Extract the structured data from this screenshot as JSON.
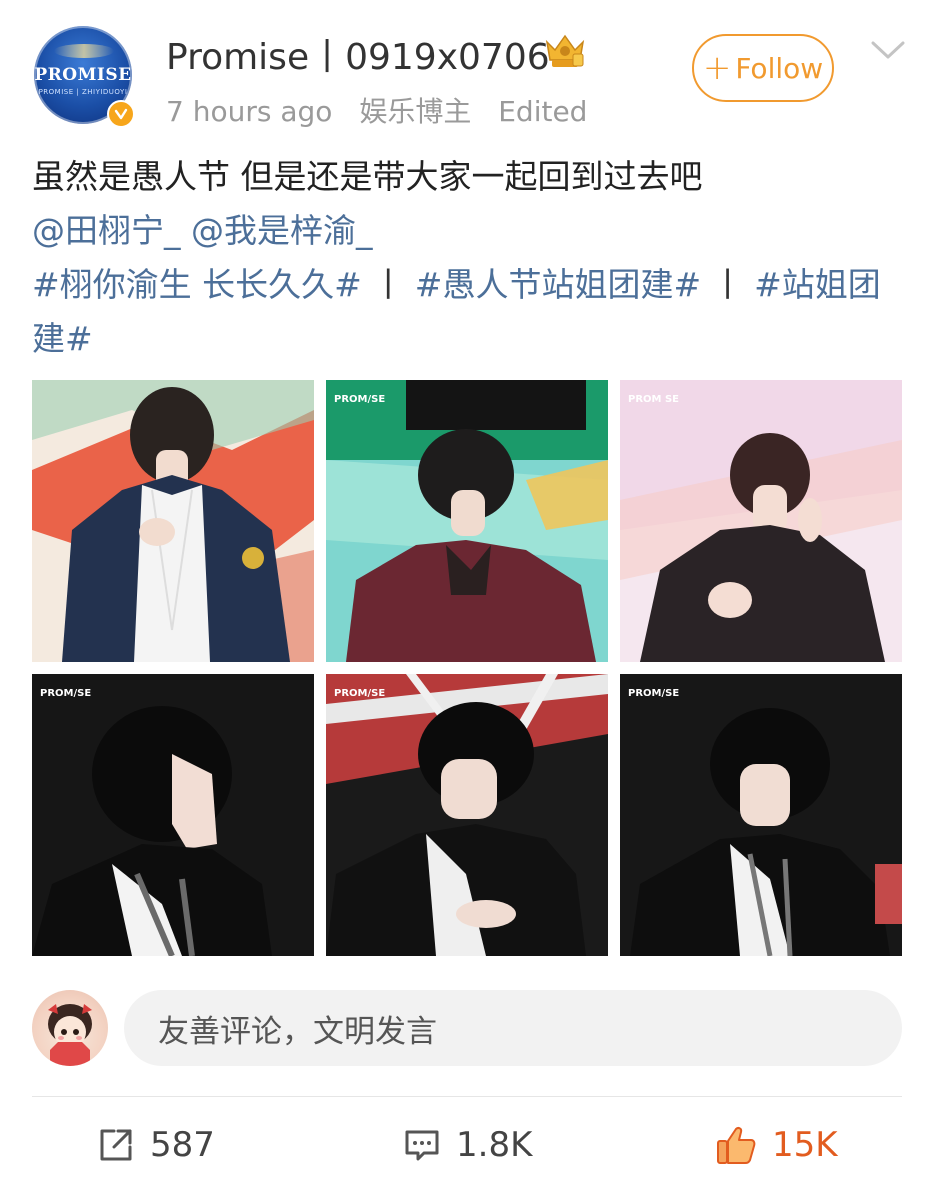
{
  "post": {
    "author": {
      "name": "Promise丨0919x0706",
      "avatar_text": "PROMISE",
      "avatar_subtext": "PROMISE | ZHIYIDUOYI",
      "verified": true
    },
    "meta": {
      "time": "7 hours ago",
      "role": "娱乐博主",
      "edited": "Edited"
    },
    "follow_label": "Follow",
    "follow_plus": "+",
    "text": {
      "line1": "虽然是愚人节 但是还是带大家一起回到过去吧",
      "mention1": "@田栩宁_",
      "mention2": "@我是梓渝_",
      "hashtag1": "#栩你渝生 长长久久#",
      "sep1": "丨",
      "hashtag2": "#愚人节站姐团建#",
      "sep2": "丨",
      "hashtag3": "#站姐团建#"
    },
    "images": [
      {
        "alt": "photo-1",
        "watermark": ""
      },
      {
        "alt": "photo-2",
        "watermark": "PROM/SE"
      },
      {
        "alt": "photo-3",
        "watermark": "PROM SE"
      },
      {
        "alt": "photo-4",
        "watermark": "PROM/SE"
      },
      {
        "alt": "photo-5",
        "watermark": "PROM/SE"
      },
      {
        "alt": "photo-6",
        "watermark": "PROM/SE"
      }
    ]
  },
  "comment_box": {
    "placeholder": "友善评论，文明发言"
  },
  "actions": {
    "share_count": "587",
    "comment_count": "1.8K",
    "like_count": "15K"
  },
  "colors": {
    "accent": "#f19a2f",
    "link": "#4c6f99",
    "like": "#e25c1f"
  }
}
